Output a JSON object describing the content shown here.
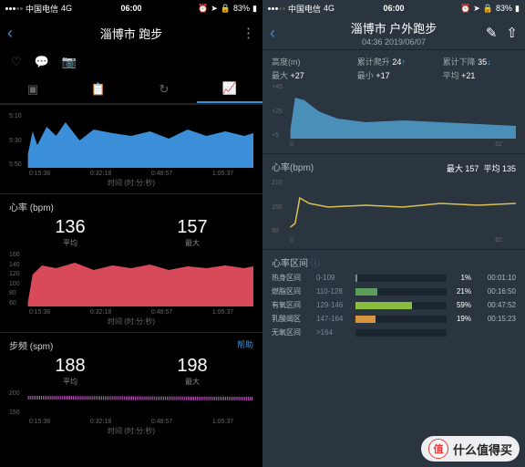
{
  "status": {
    "carrier": "中国电信",
    "net": "4G",
    "time": "06:00",
    "battery": "83%"
  },
  "left": {
    "title": "淄博市 跑步",
    "pace": {
      "yticks": [
        "5:10",
        "5:30",
        "5:50"
      ],
      "xticks": [
        "0:15:38",
        "0:32:18",
        "0:48:57",
        "1:05:37"
      ],
      "xlabel": "时间 (时:分:秒)"
    },
    "hr": {
      "title": "心率 (bpm)",
      "avg": "136",
      "avgL": "平均",
      "max": "157",
      "maxL": "最大",
      "yticks": [
        "160",
        "140",
        "120",
        "100",
        "80",
        "60"
      ],
      "xticks": [
        "0:15:38",
        "0:32:18",
        "0:48:57",
        "1:05:37"
      ],
      "xlabel": "时间 (时:分:秒)"
    },
    "cad": {
      "title": "步频 (spm)",
      "help": "帮助",
      "avg": "188",
      "avgL": "平均",
      "max": "198",
      "maxL": "最大",
      "yticks": [
        "200",
        "150"
      ],
      "xticks": [
        "0:15:38",
        "0:32:18",
        "0:48:57",
        "1:05:37"
      ],
      "xlabel": "时间 (时:分:秒)"
    }
  },
  "right": {
    "title": "淄博市 户外跑步",
    "subtitle": "04:36 2019/06/07",
    "alt": {
      "col1": "高度(m)",
      "col2": "累计爬升",
      "col2v": "24",
      "col3": "累计下降",
      "col3v": "35",
      "r1": "最大",
      "r1v": "+27",
      "r2": "最小",
      "r2v": "+17",
      "r3": "平均",
      "r3v": "+21",
      "yticks": [
        "+45",
        "+25",
        "+5"
      ],
      "xticks": [
        "0",
        "82"
      ]
    },
    "hr": {
      "title": "心率(bpm)",
      "maxL": "最大",
      "max": "157",
      "avgL": "平均",
      "avg": "135",
      "yticks": [
        "210",
        "150",
        "90"
      ],
      "xticks": [
        "0",
        "82"
      ]
    },
    "zones": {
      "title": "心率区间",
      "items": [
        {
          "name": "热身区间",
          "range": "0-109",
          "pct": "1%",
          "time": "00:01:10",
          "w": "2%",
          "c": "#7a8a95"
        },
        {
          "name": "燃脂区间",
          "range": "110-128",
          "pct": "21%",
          "time": "00:16:50",
          "w": "24%",
          "c": "#5a9e5a"
        },
        {
          "name": "有氧区间",
          "range": "129-146",
          "pct": "59%",
          "time": "00:47:52",
          "w": "62%",
          "c": "#8abd3f"
        },
        {
          "name": "乳酸阈区",
          "range": "147-164",
          "pct": "19%",
          "time": "00:15:23",
          "w": "22%",
          "c": "#d89540"
        },
        {
          "name": "无氧区间",
          "range": ">164",
          "pct": "",
          "time": "",
          "w": "0%",
          "c": "#c44"
        }
      ]
    }
  },
  "wm": {
    "icon": "值",
    "text": "什么值得买"
  }
}
